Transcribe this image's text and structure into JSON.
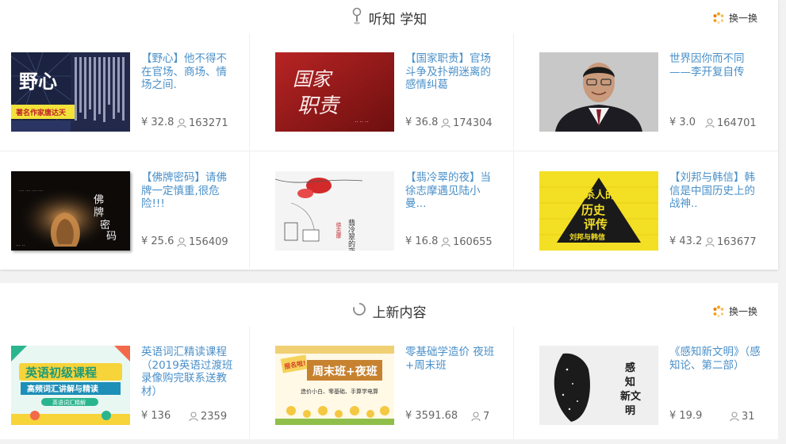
{
  "section1": {
    "title": "听知 学知",
    "refresh_label": "换一换",
    "items": [
      {
        "title": "【野心】他不得不在官场、商场、情场之间.",
        "price": "¥ 32.8",
        "views": "163271",
        "cover": "yexin"
      },
      {
        "title": "【国家职责】官场斗争及扑朔迷离的感情纠葛",
        "price": "¥ 36.8",
        "views": "174304",
        "cover": "guojiazhize"
      },
      {
        "title": "世界因你而不同——李开复自传",
        "price": "¥ 3.0",
        "views": "164701",
        "cover": "portrait"
      },
      {
        "title": "【佛牌密码】请佛牌一定慎重,很危险!!!",
        "price": "¥ 25.6",
        "views": "156409",
        "cover": "fopai"
      },
      {
        "title": "【翡冷翠的夜】当徐志摩遇见陆小曼...",
        "price": "¥ 16.8",
        "views": "160655",
        "cover": "feilengcui"
      },
      {
        "title": "【刘邦与韩信】韩信是中国历史上的战神..",
        "price": "¥ 43.2",
        "views": "163677",
        "cover": "liubang"
      }
    ],
    "cover_text": {
      "yexin_big": "野心",
      "yexin_sub": "著名作家唐达天",
      "guojia": "国家职责",
      "fopai": "佛牌密码",
      "feilengcui": "翡冷翠的夜",
      "liubang_main": "杀人的历史评传",
      "liubang_sub": "刘邦与韩信"
    }
  },
  "section2": {
    "title": "上新内容",
    "refresh_label": "换一换",
    "items": [
      {
        "title": "英语词汇精读课程（2019英语过渡班录像购完联系送教材）",
        "price": "¥ 136",
        "views": "2359",
        "cover": "english"
      },
      {
        "title": "零基础学造价 夜班+周末班",
        "price": "¥ 3591.68",
        "views": "7",
        "cover": "zaojia"
      },
      {
        "title": "《感知新文明》（感知论、第二部）",
        "price": "¥ 19.9",
        "views": "31",
        "cover": "ganzhi"
      }
    ],
    "cover_text": {
      "english_main": "英语初级课程",
      "english_sub": "高频词汇讲解与精读",
      "english_tag": "英语词汇精解",
      "zaojia_badge": "报名啦!",
      "zaojia_main": "周末班+夜班",
      "zaojia_sub": "造价小白、零基础、手算学电算",
      "ganzhi": "感知新文明"
    }
  },
  "colors": {
    "title_link": "#4a90c9",
    "accent_orange": "#f5a623",
    "text_gray": "#666666"
  }
}
